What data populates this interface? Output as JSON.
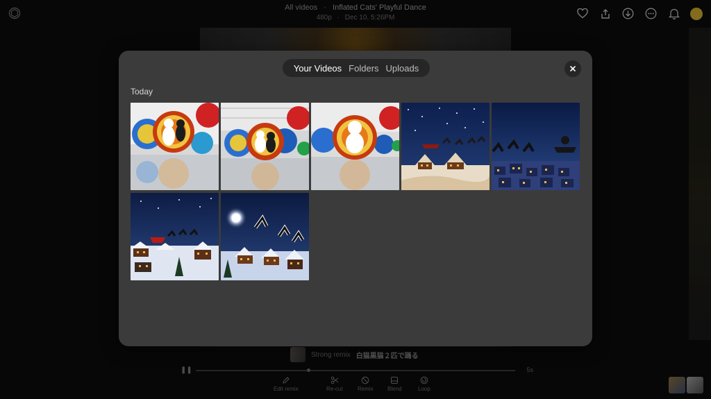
{
  "header": {
    "breadcrumb_root": "All videos",
    "breadcrumb_sep": "·",
    "video_title": "Inflated Cats' Playful Dance",
    "resolution": "480p",
    "meta_sep": "·",
    "date": "Dec 10, 5:26PM"
  },
  "top_icons": [
    "heart-icon",
    "share-icon",
    "download-icon",
    "more-icon",
    "bell-icon",
    "avatar"
  ],
  "player": {
    "remix_strength": "Strong remix",
    "remix_prompt": "白猫黒猫２匹で踊る",
    "duration": "5s"
  },
  "bottom_tools": [
    {
      "label": "Edit remix"
    },
    {
      "label": "Re-cut"
    },
    {
      "label": "Remix"
    },
    {
      "label": "Blend"
    },
    {
      "label": "Loop"
    }
  ],
  "modal": {
    "tabs": [
      {
        "label": "Your Videos",
        "active": true
      },
      {
        "label": "Folders",
        "active": false
      },
      {
        "label": "Uploads",
        "active": false
      }
    ],
    "section_label": "Today",
    "videos": [
      {
        "subject": "white cat with inflated balloons, reflective floor",
        "theme": "cat"
      },
      {
        "subject": "white cat and black cat with inflated balloons",
        "theme": "cat"
      },
      {
        "subject": "white cat sitting in front of inflated balloons",
        "theme": "cat"
      },
      {
        "subject": "santa sleigh with reindeer over snowy village",
        "theme": "christmas"
      },
      {
        "subject": "reindeer silhouettes above lit village",
        "theme": "christmas"
      },
      {
        "subject": "sleigh over snowy village at night",
        "theme": "christmas"
      },
      {
        "subject": "reindeer flying past full moon over village",
        "theme": "christmas"
      }
    ]
  },
  "colors": {
    "modal_bg": "#3b3b3b",
    "tab_pill_bg": "#262626",
    "page_bg": "#0b0b0b",
    "avatar": "#c9a72a"
  }
}
